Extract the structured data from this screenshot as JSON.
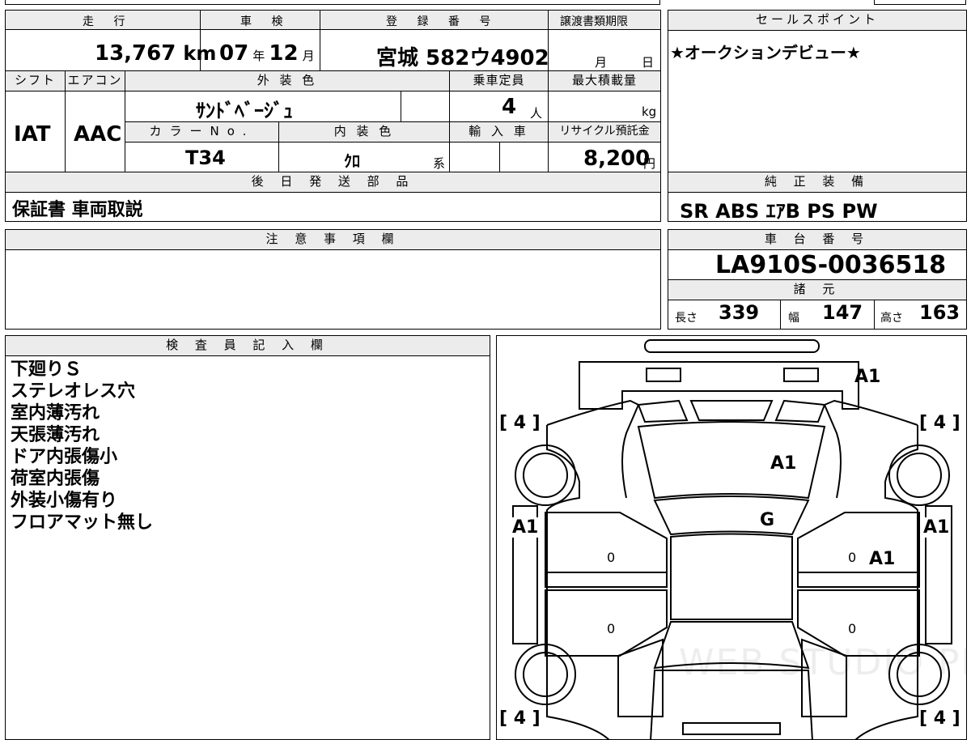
{
  "headers": {
    "mileage": "走 行",
    "inspection": "車 検",
    "registration": "登 録 番 号",
    "transfer_deadline": "譲渡書類期限",
    "sales_point": "セールスポイント",
    "shift": "シフト",
    "aircon": "エアコン",
    "exterior_color": "外 装 色",
    "capacity": "乗車定員",
    "max_load": "最大積載量",
    "color_no": "カラーNo.",
    "interior_color": "内 装 色",
    "import": "輸 入 車",
    "recycle": "リサイクル預託金",
    "later_parts": "後 日 発 送 部 品",
    "genuine_equipment": "純 正 装 備",
    "notes": "注 意 事 項 欄",
    "chassis_no": "車 台 番 号",
    "specs": "諸 元",
    "inspector": "検 査 員 記 入 欄"
  },
  "mileage": {
    "value": "13,767",
    "unit": "km"
  },
  "inspection": {
    "year": "07",
    "year_unit": "年",
    "month": "12",
    "month_unit": "月"
  },
  "registration": {
    "value": "宮城 582ウ4902"
  },
  "transfer_deadline": {
    "month_unit": "月",
    "day_unit": "日"
  },
  "sales_point": {
    "text": "★オークションデビュー★"
  },
  "shift": {
    "value": "IAT"
  },
  "aircon": {
    "value": "AAC"
  },
  "exterior_color": {
    "value": "ｻﾝﾄﾞﾍﾞｰｼﾞｭ"
  },
  "capacity": {
    "value": "4",
    "unit": "人"
  },
  "max_load": {
    "unit": "kg"
  },
  "color_no": {
    "value": "T34"
  },
  "interior_color": {
    "value": "ｸﾛ",
    "suffix": "系"
  },
  "recycle": {
    "value": "8,200",
    "unit": "円"
  },
  "later_parts": {
    "value": "保証書 車両取説"
  },
  "genuine_equipment": {
    "value": "SR ABS ｴｱB PS PW"
  },
  "chassis_no": {
    "value": "LA910S-0036518"
  },
  "specs": {
    "length_label": "長さ",
    "length": "339",
    "width_label": "幅",
    "width": "147",
    "height_label": "高さ",
    "height": "163"
  },
  "inspector_notes": [
    "下廻りＳ",
    "ステレオレス穴",
    "室内薄汚れ",
    "天張薄汚れ",
    "ドア内張傷小",
    "荷室内張傷",
    "外装小傷有り",
    "フロアマット無し"
  ],
  "diagram": {
    "tire_fl": "[ 4 ]",
    "tire_fr": "[ 4 ]",
    "tire_rl": "[ 4 ]",
    "tire_rr": "[ 4 ]",
    "front_bumper": "A1",
    "hood": "A1",
    "windshield": "G",
    "left_fender": "A1",
    "right_fender": "A1",
    "right_front_door": "A1",
    "door_lf": "0",
    "door_lr": "0",
    "door_rf": "0",
    "door_rr": "0",
    "watermark": "WEB STUDIO PRO"
  }
}
